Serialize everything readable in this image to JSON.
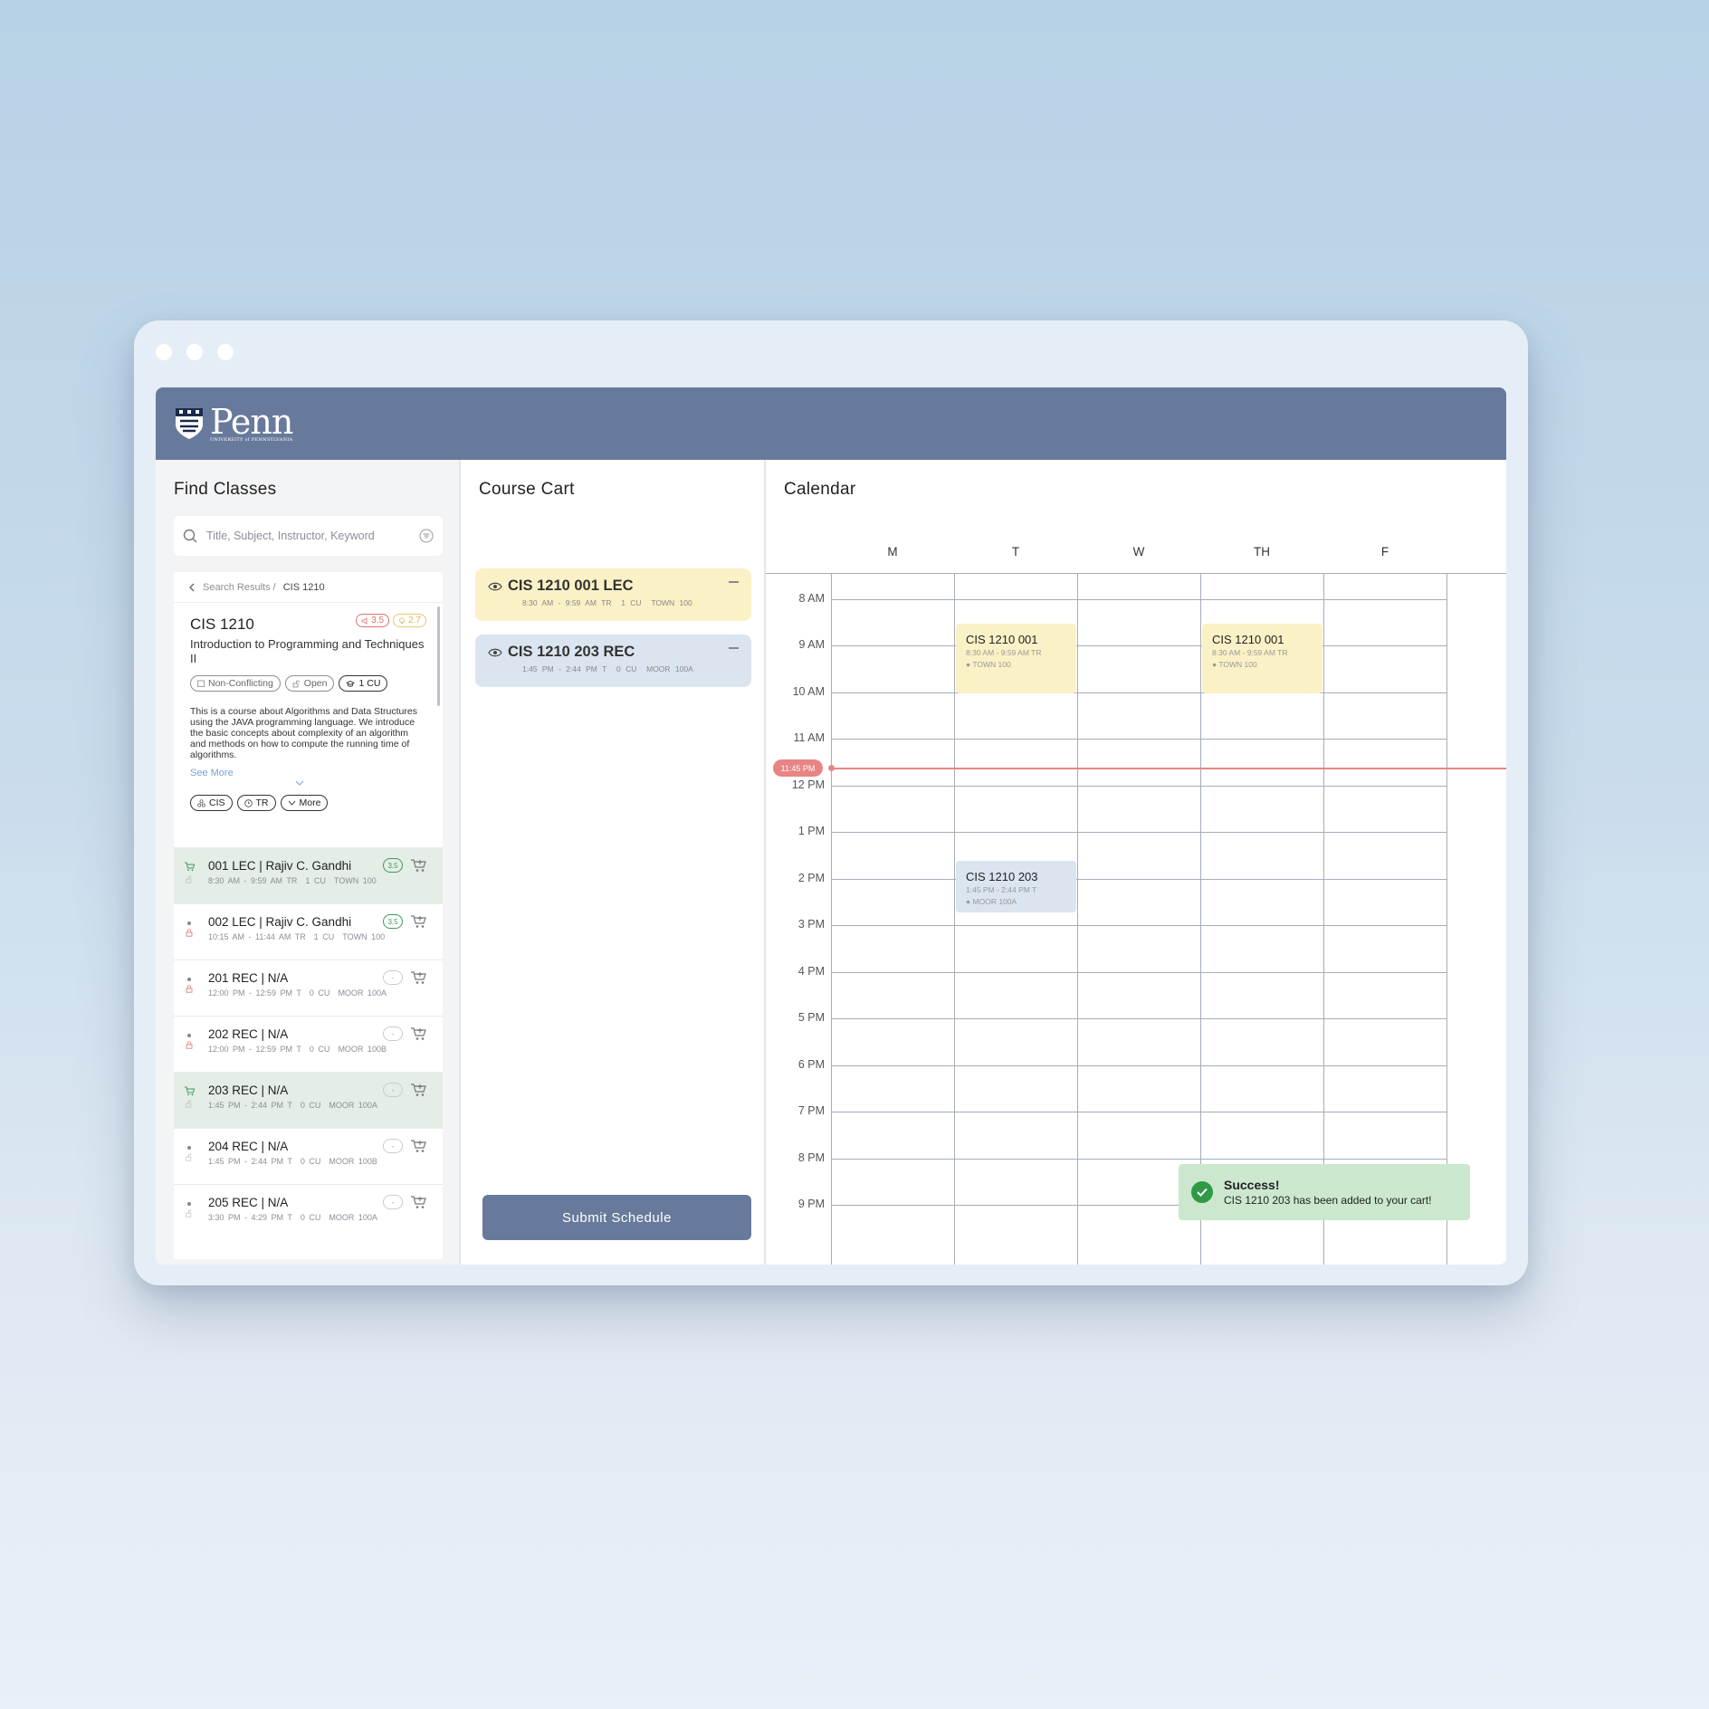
{
  "logo": {
    "text": "Penn",
    "sub": "UNIVERSITY of PENNSYLVANIA"
  },
  "find": {
    "title": "Find Classes",
    "search_placeholder": "Title, Subject, Instructor, Keyword",
    "breadcrumb": {
      "parent": "Search Results /",
      "current": "CIS 1210"
    },
    "course": {
      "code": "CIS 1210",
      "rating1": "3.5",
      "rating2": "2.7",
      "name": "Introduction to Programming and Techniques II",
      "tags": [
        "Non-Conflicting",
        "Open",
        "1 CU"
      ],
      "description": "This is a course about Algorithms and Data Structures using the JAVA programming language. We introduce the basic concepts about complexity of an algorithm and methods on how to compute the running time of algorithms.",
      "see_more": "See More",
      "filters": [
        "CIS",
        "TR",
        "More"
      ]
    },
    "sections": [
      {
        "title": "001 LEC | Rajiv C. Gandhi",
        "time": "8:30 AM - 9:59 AM TR",
        "cu": "1 CU",
        "room": "TOWN 100",
        "rating": "3.5",
        "selected": true
      },
      {
        "title": "002 LEC | Rajiv C. Gandhi",
        "time": "10:15 AM - 11:44 AM TR",
        "cu": "1 CU",
        "room": "TOWN 100",
        "rating": "3.5",
        "selected": false
      },
      {
        "title": "201 REC | N/A",
        "time": "12:00 PM - 12:59 PM T",
        "cu": "0 CU",
        "room": "MOOR 100A",
        "rating": "-",
        "selected": false
      },
      {
        "title": "202 REC | N/A",
        "time": "12:00 PM - 12:59 PM T",
        "cu": "0 CU",
        "room": "MOOR 100B",
        "rating": "-",
        "selected": false
      },
      {
        "title": "203 REC | N/A",
        "time": "1:45 PM - 2:44 PM T",
        "cu": "0 CU",
        "room": "MOOR 100A",
        "rating": "-",
        "selected": true
      },
      {
        "title": "204 REC | N/A",
        "time": "1:45 PM - 2:44 PM T",
        "cu": "0 CU",
        "room": "MOOR 100B",
        "rating": "-",
        "selected": false
      },
      {
        "title": "205 REC | N/A",
        "time": "3:30 PM - 4:29 PM T",
        "cu": "0 CU",
        "room": "MOOR 100A",
        "rating": "-",
        "selected": false
      }
    ]
  },
  "cart": {
    "title": "Course Cart",
    "items": [
      {
        "title": "CIS 1210 001 LEC",
        "time": "8:30 AM - 9:59 AM TR",
        "cu": "1 CU",
        "room": "TOWN 100"
      },
      {
        "title": "CIS 1210 203 REC",
        "time": "1:45 PM - 2:44 PM T",
        "cu": "0 CU",
        "room": "MOOR 100A"
      }
    ],
    "submit": "Submit Schedule"
  },
  "calendar": {
    "title": "Calendar",
    "days": [
      "M",
      "T",
      "W",
      "TH",
      "F"
    ],
    "times": [
      "8 AM",
      "9 AM",
      "10 AM",
      "11 AM",
      "12 PM",
      "1 PM",
      "2 PM",
      "3 PM",
      "4 PM",
      "5 PM",
      "6 PM",
      "7 PM",
      "8 PM",
      "9 PM"
    ],
    "now": "11:45 PM",
    "events": [
      {
        "title": "CIS 1210 001",
        "time": "8:30 AM - 9:59 AM TR",
        "room": "TOWN 100",
        "day": "T",
        "color": "#fbf1c6"
      },
      {
        "title": "CIS 1210 001",
        "time": "8:30 AM - 9:59 AM TR",
        "room": "TOWN 100",
        "day": "TH",
        "color": "#fbf1c6"
      },
      {
        "title": "CIS 1210 203",
        "time": "1:45 PM - 2:44 PM T",
        "room": "MOOR 100A",
        "day": "T",
        "color": "#dbe5f0"
      }
    ]
  },
  "toast": {
    "title": "Success!",
    "message": "CIS 1210 203 has been added to your cart!"
  },
  "colors": {
    "header": "#687a9c",
    "accent_green": "#2e9a45",
    "now": "#e88584",
    "lec": "#fbf1c6",
    "rec": "#dbe5f0"
  }
}
